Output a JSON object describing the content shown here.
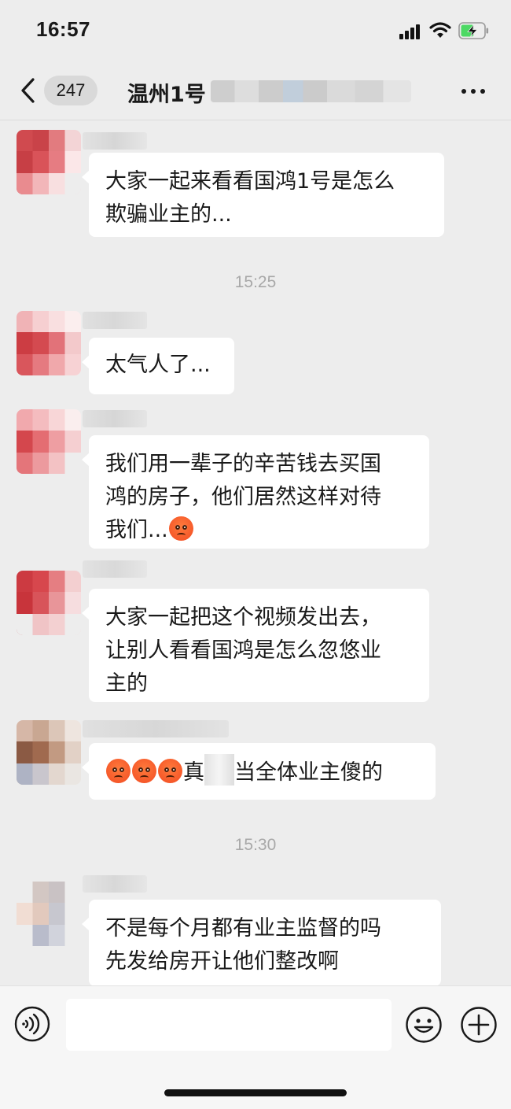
{
  "status_bar": {
    "time": "16:57",
    "signal_icon": "cellular-signal-icon",
    "wifi_icon": "wifi-icon",
    "battery_icon": "battery-charging-icon",
    "battery_color": "#4cd964"
  },
  "nav": {
    "back_icon": "chevron-left-icon",
    "unread_count": "247",
    "title": "温州1号",
    "more_icon": "more-dots-icon"
  },
  "messages": [
    {
      "text": "大家一起来看看国鸿1号是怎么\n欺骗业主的..."
    },
    {
      "timestamp": "15:25"
    },
    {
      "text": "太气人了..."
    },
    {
      "text_lines": [
        "我们用一辈子的辛苦钱去买国",
        "鸿的房子，他们居然这样对待",
        "我们..."
      ],
      "emoji": "angry-face-emoji"
    },
    {
      "text": "大家一起把这个视频发出去，\n让别人看看国鸿是怎么忽悠业\n主的"
    },
    {
      "emojis": [
        "angry-face-emoji",
        "angry-face-emoji",
        "angry-face-emoji"
      ],
      "text_before": "真",
      "text_after": "当全体业主傻的"
    },
    {
      "timestamp": "15:30"
    },
    {
      "text": "不是每个月都有业主监督的吗\n先发给房开让他们整改啊"
    }
  ],
  "input_bar": {
    "voice_icon": "voice-input-icon",
    "input_value": "",
    "emoji_icon": "emoji-smile-icon",
    "plus_icon": "plus-circle-icon"
  },
  "colors": {
    "background": "#ededed",
    "bubble": "#ffffff",
    "text": "#191919",
    "timestamp": "#a8a8a8"
  }
}
